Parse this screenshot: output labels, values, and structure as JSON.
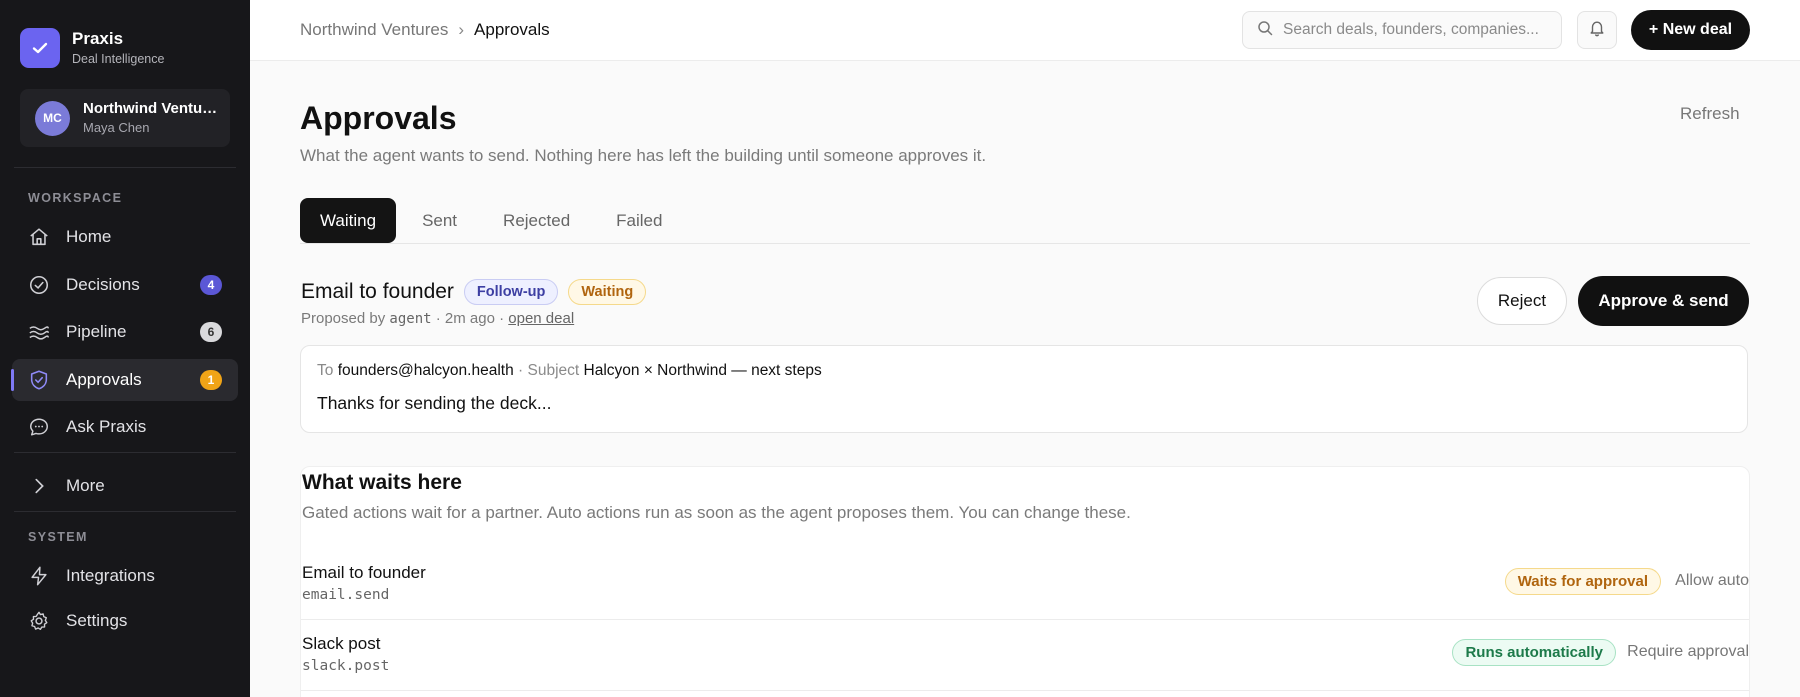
{
  "brand": {
    "name": "Praxis",
    "subtitle": "Deal Intelligence"
  },
  "org": {
    "initials": "MC",
    "name": "Northwind Ventures",
    "user": "Maya Chen"
  },
  "sidebar": {
    "workspace_label": "WORKSPACE",
    "system_label": "SYSTEM",
    "items": [
      {
        "label": "Home",
        "icon": "home-icon"
      },
      {
        "label": "Decisions",
        "icon": "check-circle-icon",
        "badge": "4",
        "badge_color": "#5b57d6"
      },
      {
        "label": "Pipeline",
        "icon": "waves-icon",
        "badge": "6",
        "badge_color": "#d9d9dc"
      },
      {
        "label": "Approvals",
        "icon": "shield-check-icon",
        "badge": "1",
        "badge_color": "#f0a417",
        "active": true
      },
      {
        "label": "Ask Praxis",
        "icon": "chat-icon"
      }
    ],
    "more_label": "More",
    "system_items": [
      {
        "label": "Integrations",
        "icon": "lightning-icon"
      },
      {
        "label": "Settings",
        "icon": "gear-icon"
      }
    ]
  },
  "topbar": {
    "breadcrumb": [
      "Northwind Ventures",
      "Approvals"
    ],
    "search_placeholder": "Search deals, founders, companies...",
    "new_deal_label": "+ New deal"
  },
  "page": {
    "title": "Approvals",
    "subtitle": "What the agent wants to send. Nothing here has left the building until someone approves it.",
    "refresh_label": "Refresh",
    "tabs": [
      "Waiting",
      "Sent",
      "Rejected",
      "Failed"
    ],
    "active_tab": "Waiting"
  },
  "email_card": {
    "title": "Email to founder",
    "tag": "Follow-up",
    "status": "Waiting",
    "meta_prefix": "Proposed by",
    "meta_agent": "agent",
    "meta_time": "· 2m ago ·",
    "meta_link": "open deal",
    "reject_label": "Reject",
    "approve_label": "Approve & send",
    "to_label": "To",
    "to_value": "founders@halcyon.health",
    "subject_label": "· Subject",
    "subject_value": "Halcyon × Northwind — next steps",
    "body": "Thanks for sending the deck..."
  },
  "waits": {
    "title": "What waits here",
    "subtitle": "Gated actions wait for a partner. Auto actions run as soon as the agent proposes them. You can change these.",
    "rows": [
      {
        "name": "Email to founder",
        "code": "email.send",
        "status": "Waits for approval",
        "action": "Allow auto"
      },
      {
        "name": "Slack post",
        "code": "slack.post",
        "status": "Runs automatically",
        "action": "Require approval"
      }
    ]
  }
}
